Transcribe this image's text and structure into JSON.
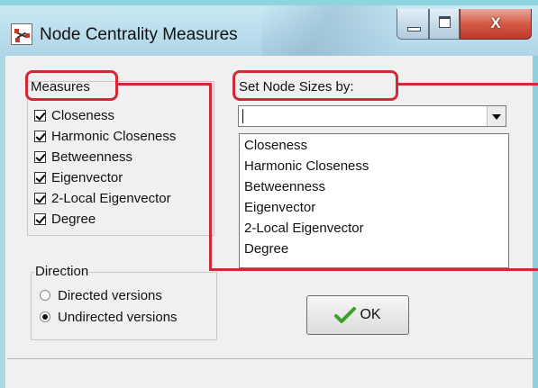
{
  "window": {
    "title": "Node Centrality Measures",
    "close_label": "X"
  },
  "measures": {
    "title": "Measures",
    "items": [
      {
        "label": "Closeness",
        "checked": true
      },
      {
        "label": "Harmonic Closeness",
        "checked": true
      },
      {
        "label": "Betweenness",
        "checked": true
      },
      {
        "label": "Eigenvector",
        "checked": true
      },
      {
        "label": "2-Local Eigenvector",
        "checked": true
      },
      {
        "label": "Degree",
        "checked": true
      }
    ]
  },
  "node_sizes": {
    "title": "Set Node Sizes by:",
    "combo_value": "",
    "options": [
      "Closeness",
      "Harmonic Closeness",
      "Betweenness",
      "Eigenvector",
      "2-Local Eigenvector",
      "Degree"
    ]
  },
  "direction": {
    "title": "Direction",
    "options": [
      {
        "label": "Directed versions",
        "selected": false
      },
      {
        "label": "Undirected versions",
        "selected": true
      }
    ]
  },
  "ok_button": {
    "label": "OK"
  },
  "colors": {
    "annotation": "#d02a36",
    "ok_check": "#3aa12a"
  }
}
